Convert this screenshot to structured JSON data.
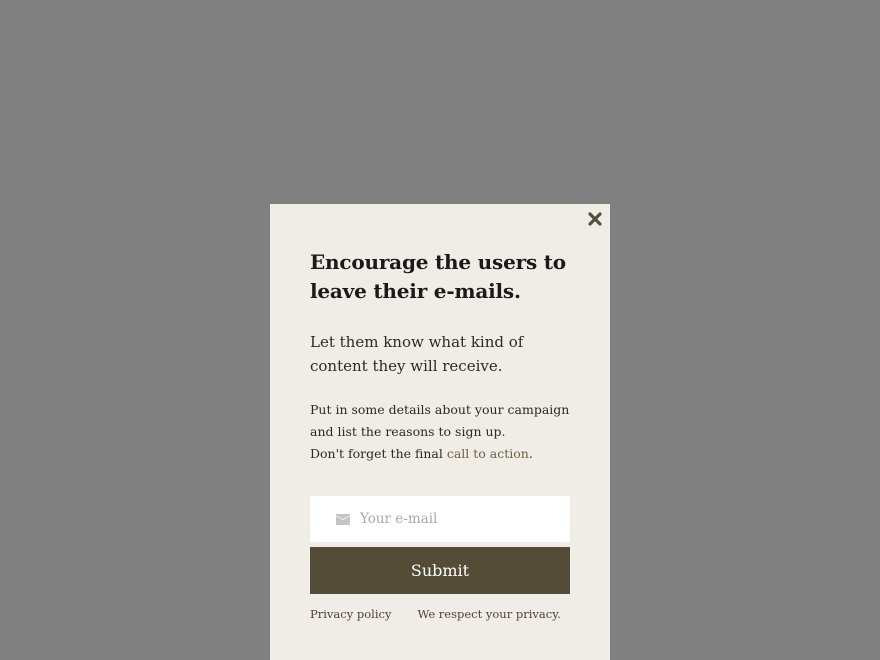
{
  "colors": {
    "overlay": "#808080",
    "modal_background": "#f0ede6",
    "heading_text": "#1a1a1a",
    "body_text": "#2a2a2a",
    "link_text": "#6b6147",
    "close_icon": "#55503c",
    "input_background": "#ffffff",
    "placeholder_text": "#a8a8a8",
    "mail_icon": "#c4c4c4",
    "button_background": "#544c37",
    "button_text": "#ffffff",
    "footer_text": "#4a4535"
  },
  "modal": {
    "close_icon": "close-icon",
    "headline": "Encourage the users to leave their e-mails.",
    "lead": "Let them know what kind of content they will receive.",
    "details": {
      "line1": "Put in some details about your campaign",
      "line2": "and list the reasons to sign up.",
      "line3_prefix": "Don't forget the final ",
      "cta_link": "call to action",
      "line3_suffix": "."
    },
    "email": {
      "icon": "envelope-icon",
      "placeholder": "Your e-mail",
      "value": ""
    },
    "submit_label": "Submit",
    "footer": {
      "privacy_link": "Privacy policy",
      "privacy_note": "We respect your privacy."
    }
  }
}
